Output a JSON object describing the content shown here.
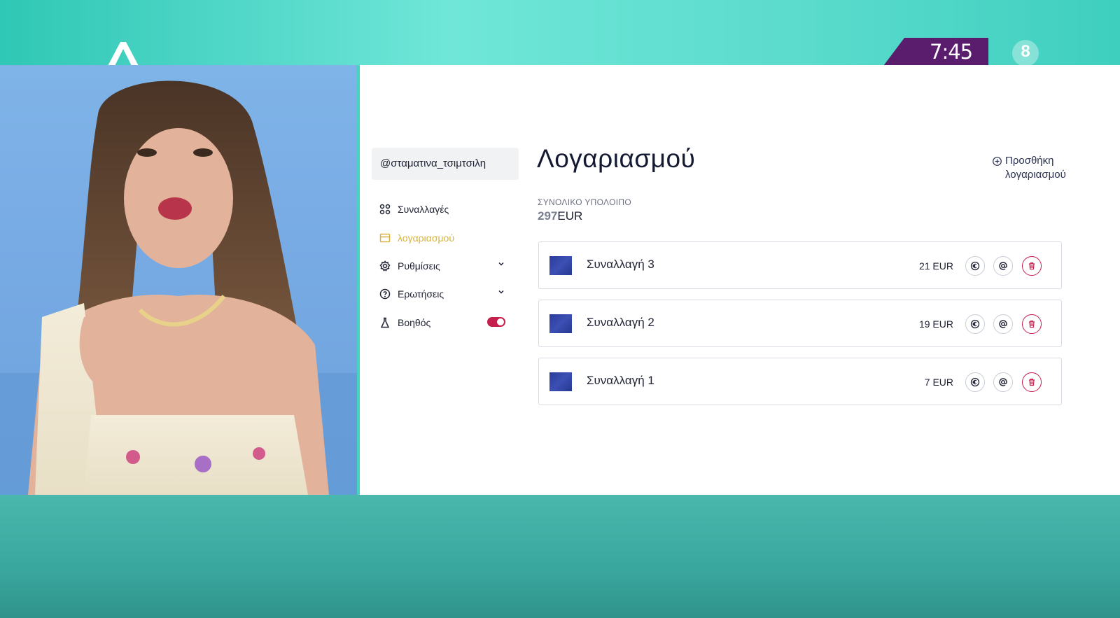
{
  "broadcast": {
    "clock": "7:45",
    "rating": "8"
  },
  "sidebar": {
    "username": "@σταματινα_τσιμτσιλη",
    "items": [
      {
        "label": "Συναλλαγές",
        "icon": "grid-icon",
        "active": false
      },
      {
        "label": "λογαριασμού",
        "icon": "card-icon",
        "active": true
      },
      {
        "label": "Ρυθμίσεις",
        "icon": "settings-icon",
        "active": false,
        "expandable": true
      },
      {
        "label": "Ερωτήσεις",
        "icon": "help-icon",
        "active": false,
        "expandable": true
      },
      {
        "label": "Βοηθός",
        "icon": "flask-icon",
        "active": false,
        "toggle": true,
        "toggle_on": true
      }
    ]
  },
  "main": {
    "title": "Λογαριασμού",
    "add_account_line1": "Προσθήκη",
    "add_account_line2": "λογαριασμού",
    "balance_label": "ΣΥΝΟΛΙΚΟ ΥΠΟΛΟΙΠΟ",
    "balance_number": "297",
    "balance_currency": "EUR",
    "transactions": [
      {
        "name": "Συναλλαγή 3",
        "amount": "21 EUR"
      },
      {
        "name": "Συναλλαγή 2",
        "amount": "19 EUR"
      },
      {
        "name": "Συναλλαγή 1",
        "amount": "7 EUR"
      }
    ]
  },
  "colors": {
    "accent_gold": "#d6b43a",
    "danger": "#c41f4d",
    "thumb_blue": "#2a3d9a"
  }
}
